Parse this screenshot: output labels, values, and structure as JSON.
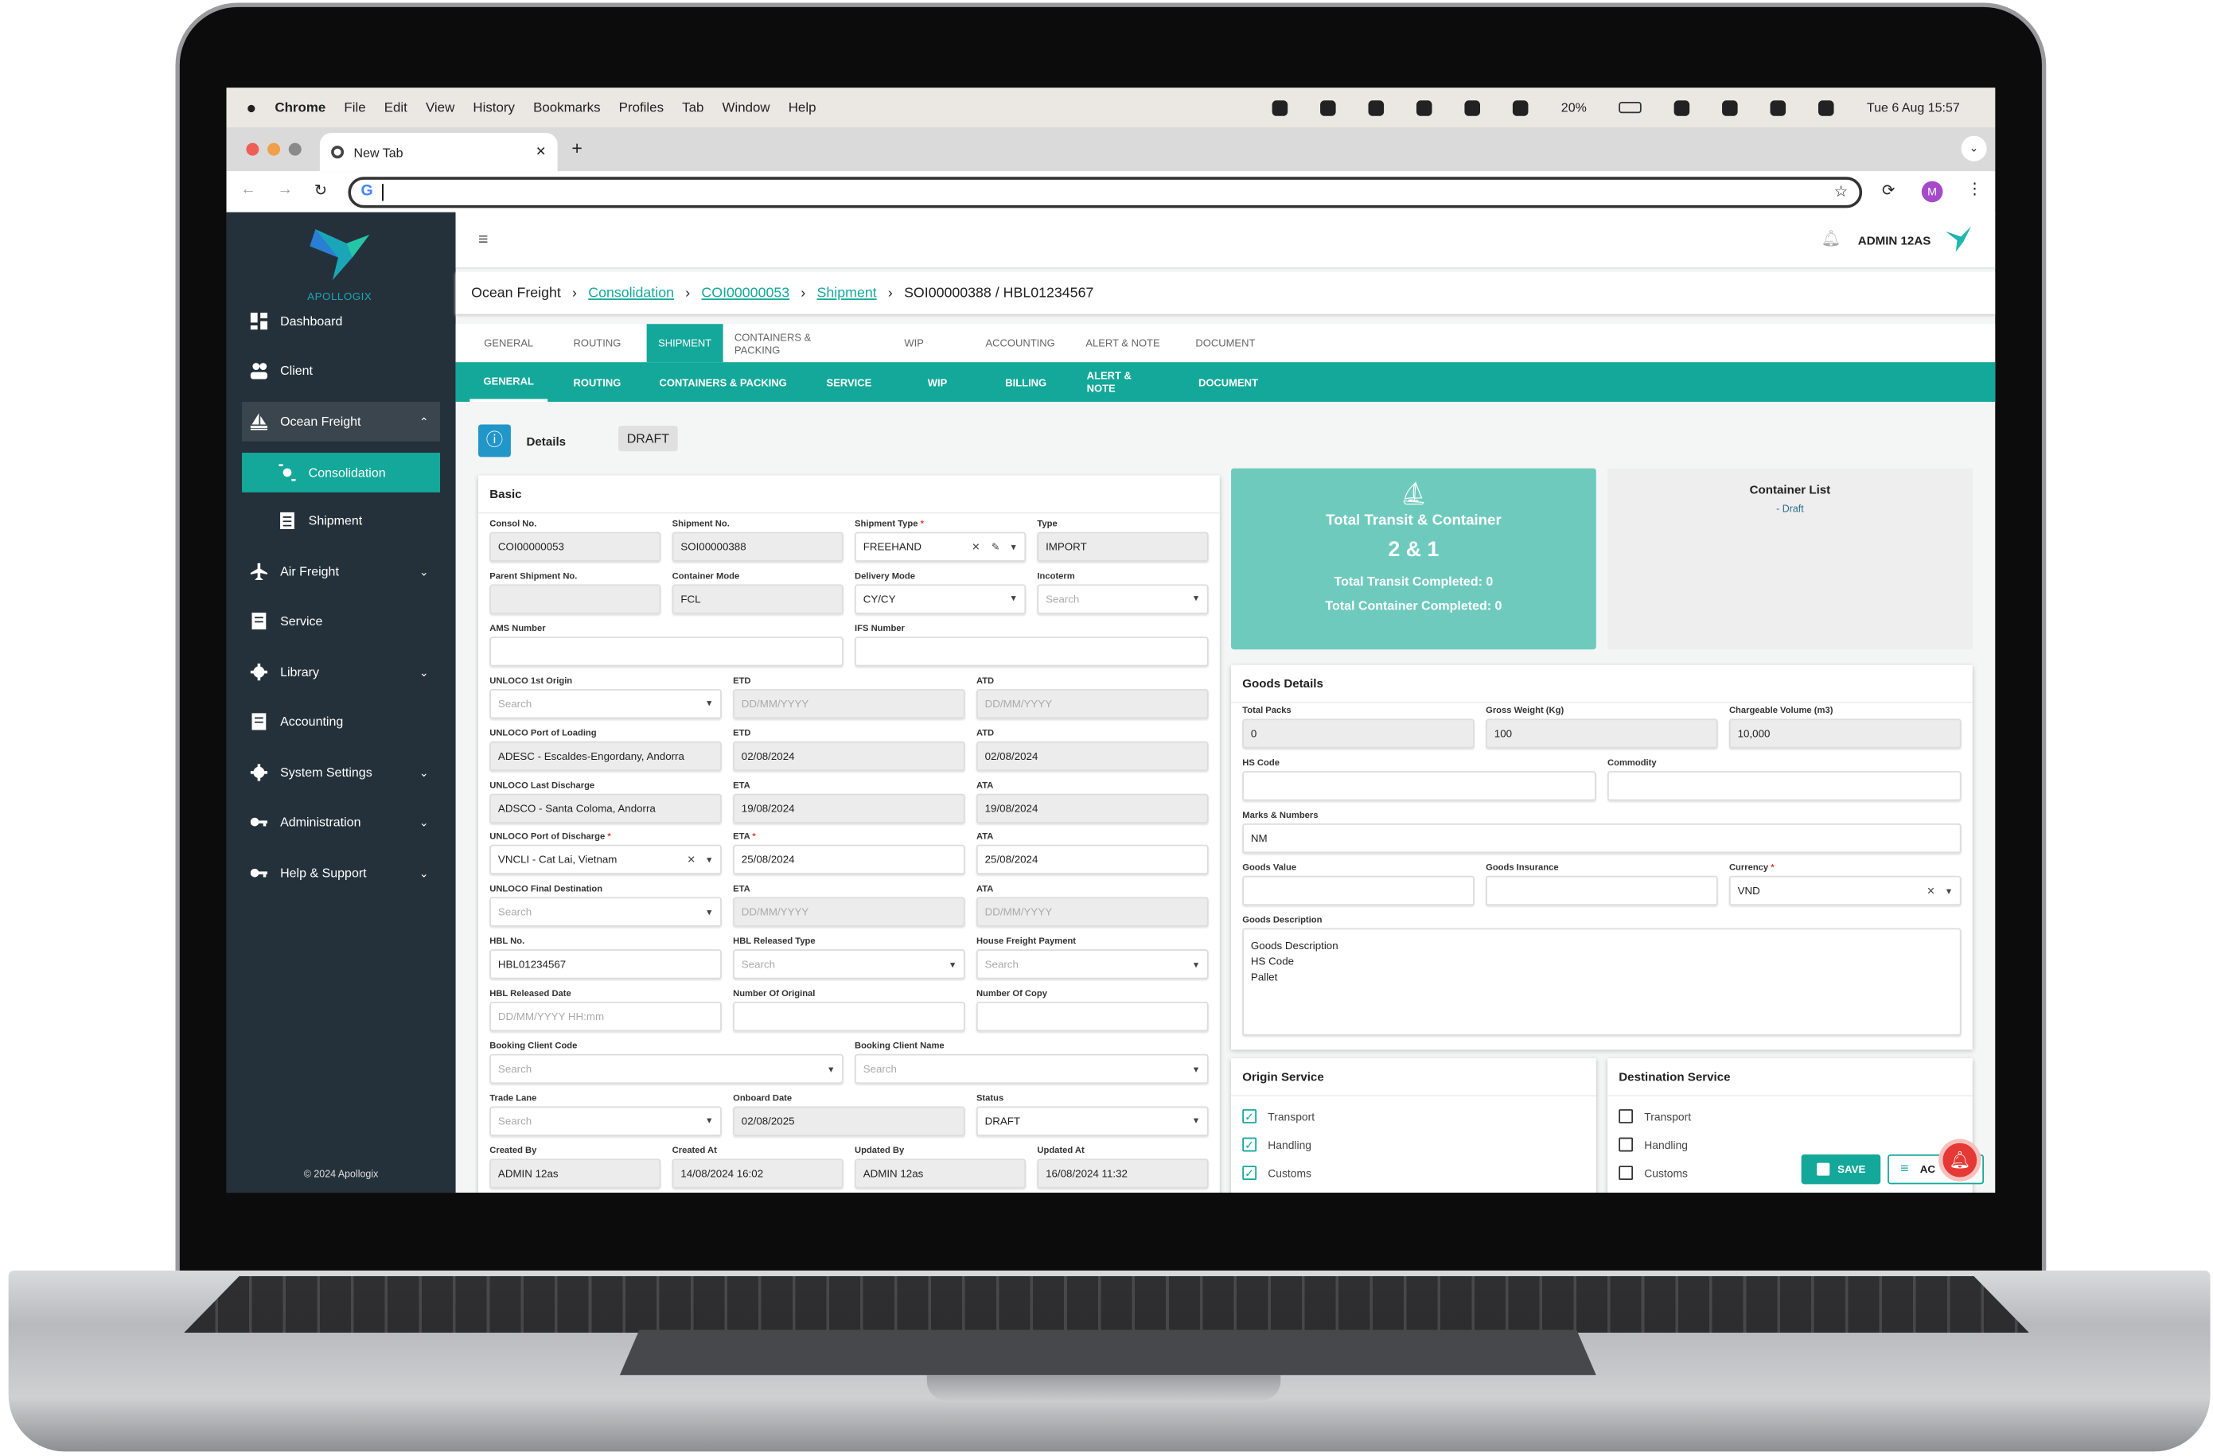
{
  "colors": {
    "accent": "#14a89a",
    "sidebar": "#25313a",
    "summary": "#6fcabe",
    "alert": "#e53935"
  },
  "mac_menu": {
    "items": [
      "Chrome",
      "File",
      "Edit",
      "View",
      "History",
      "Bookmarks",
      "Profiles",
      "Tab",
      "Window",
      "Help"
    ],
    "battery": "20%",
    "datetime": "Tue 6 Aug  15:57",
    "status_icons": [
      "vivaldi-icon",
      "screen-icon",
      "cloud-icon",
      "chat-icon",
      "grammarly-icon",
      "check-icon",
      "wifi-icon",
      "search-icon",
      "control-center-icon",
      "siri-icon"
    ]
  },
  "browser": {
    "tab_title": "New Tab",
    "new_tab": "+",
    "address": "",
    "avatar": "M"
  },
  "sidebar": {
    "logo": "APOLLOGIX",
    "footer": "© 2024 Apollogix",
    "items": [
      {
        "label": "Dashboard",
        "icon": "dashboard-icon"
      },
      {
        "label": "Client",
        "icon": "users-icon"
      },
      {
        "label": "Ocean Freight",
        "icon": "ship-icon",
        "expanded": true
      },
      {
        "label": "Consolidation",
        "icon": "consolidation-icon",
        "sub": true,
        "active": true
      },
      {
        "label": "Shipment",
        "icon": "document-icon",
        "sub": true
      },
      {
        "label": "Air Freight",
        "icon": "plane-icon",
        "chevron": true
      },
      {
        "label": "Service",
        "icon": "list-icon"
      },
      {
        "label": "Library",
        "icon": "gear-icon",
        "chevron": true
      },
      {
        "label": "Accounting",
        "icon": "list-icon"
      },
      {
        "label": "System Settings",
        "icon": "gear-icon",
        "chevron": true
      },
      {
        "label": "Administration",
        "icon": "key-icon",
        "chevron": true
      },
      {
        "label": "Help & Support",
        "icon": "key-icon",
        "chevron": true
      }
    ]
  },
  "header": {
    "user": "ADMIN 12AS"
  },
  "breadcrumb": {
    "root": "Ocean Freight",
    "links": [
      "Consolidation",
      "COI00000053",
      "Shipment"
    ],
    "current": "SOI00000388 / HBL01234567"
  },
  "tabs_primary": [
    {
      "label": "General"
    },
    {
      "label": "Routing"
    },
    {
      "label": "Shipment",
      "active": true
    },
    {
      "label": "Containers & Packing"
    },
    {
      "label": "WIP"
    },
    {
      "label": "Accounting"
    },
    {
      "label": "Alert & Note"
    },
    {
      "label": "Document"
    }
  ],
  "tabs_secondary": [
    {
      "label": "General",
      "active": true
    },
    {
      "label": "Routing"
    },
    {
      "label": "Containers & Packing"
    },
    {
      "label": "Service"
    },
    {
      "label": "WIP"
    },
    {
      "label": "Billing"
    },
    {
      "label": "Alert & Note"
    },
    {
      "label": "Document"
    }
  ],
  "details": {
    "title": "Details",
    "status_badge": "DRAFT",
    "section": "Basic"
  },
  "basic_rows": [
    [
      {
        "label": "Consol No.",
        "value": "COI00000053",
        "disabled": true
      },
      {
        "label": "Shipment No.",
        "value": "SOI00000388",
        "disabled": true
      },
      {
        "label": "Shipment Type",
        "required": true,
        "value": "FREEHAND",
        "select": true,
        "clear": true,
        "edit": true
      },
      {
        "label": "Type",
        "value": "IMPORT",
        "disabled": true
      }
    ],
    [
      {
        "label": "Parent Shipment No.",
        "value": "",
        "disabled": true
      },
      {
        "label": "Container Mode",
        "value": "FCL",
        "disabled": true
      },
      {
        "label": "Delivery Mode",
        "value": "CY/CY",
        "select": true
      },
      {
        "label": "Incoterm",
        "placeholder": "Search",
        "select": true
      }
    ],
    [
      {
        "label": "AMS Number",
        "value": ""
      },
      {
        "label": "IFS Number",
        "value": ""
      }
    ],
    [
      {
        "label": "UNLOCO 1st Origin",
        "placeholder": "Search",
        "select": true
      },
      {
        "label": "ETD",
        "placeholder": "DD/MM/YYYY",
        "disabled": true
      },
      {
        "label": "ATD",
        "placeholder": "DD/MM/YYYY",
        "disabled": true
      }
    ],
    [
      {
        "label": "UNLOCO Port of Loading",
        "value": "ADESC - Escaldes-Engordany, Andorra",
        "disabled": true
      },
      {
        "label": "ETD",
        "value": "02/08/2024",
        "disabled": true
      },
      {
        "label": "ATD",
        "value": "02/08/2024",
        "disabled": true
      }
    ],
    [
      {
        "label": "UNLOCO Last Discharge",
        "value": "ADSCO - Santa Coloma, Andorra",
        "disabled": true
      },
      {
        "label": "ETA",
        "value": "19/08/2024",
        "disabled": true
      },
      {
        "label": "ATA",
        "value": "19/08/2024",
        "disabled": true
      }
    ],
    [
      {
        "label": "UNLOCO Port of Discharge",
        "required": true,
        "value": "VNCLI - Cat Lai, Vietnam",
        "select": true,
        "clear": true
      },
      {
        "label": "ETA",
        "required": true,
        "value": "25/08/2024"
      },
      {
        "label": "ATA",
        "value": "25/08/2024"
      }
    ],
    [
      {
        "label": "UNLOCO Final Destination",
        "placeholder": "Search",
        "select": true
      },
      {
        "label": "ETA",
        "placeholder": "DD/MM/YYYY",
        "disabled": true
      },
      {
        "label": "ATA",
        "placeholder": "DD/MM/YYYY",
        "disabled": true
      }
    ],
    [
      {
        "label": "HBL No.",
        "value": "HBL01234567"
      },
      {
        "label": "HBL Released Type",
        "placeholder": "Search",
        "select": true
      },
      {
        "label": "House Freight Payment",
        "placeholder": "Search",
        "select": true
      }
    ],
    [
      {
        "label": "HBL Released Date",
        "placeholder": "DD/MM/YYYY HH:mm"
      },
      {
        "label": "Number Of Original",
        "value": ""
      },
      {
        "label": "Number Of Copy",
        "value": ""
      }
    ],
    [
      {
        "label": "Booking Client Code",
        "placeholder": "Search",
        "select": true
      },
      {
        "label": "Booking Client Name",
        "placeholder": "Search",
        "select": true
      }
    ],
    [
      {
        "label": "Trade Lane",
        "placeholder": "Search",
        "select": true
      },
      {
        "label": "Onboard Date",
        "value": "02/08/2025",
        "disabled": true
      },
      {
        "label": "Status",
        "value": "DRAFT",
        "select": true
      }
    ],
    [
      {
        "label": "Created By",
        "value": "ADMIN 12as",
        "disabled": true
      },
      {
        "label": "Created At",
        "value": "14/08/2024 16:02",
        "disabled": true
      },
      {
        "label": "Updated By",
        "value": "ADMIN 12as",
        "disabled": true
      },
      {
        "label": "Updated At",
        "value": "16/08/2024 11:32",
        "disabled": true
      }
    ]
  ],
  "summary": {
    "title": "Total Transit & Container",
    "value": "2 & 1",
    "transit_completed": "Total Transit Completed: 0",
    "container_completed": "Total Container Completed: 0"
  },
  "container_list": {
    "title": "Container List",
    "items": [
      "- Draft"
    ]
  },
  "goods": {
    "title": "Goods Details",
    "rows": [
      [
        {
          "label": "Total Packs",
          "value": "0",
          "disabled": true
        },
        {
          "label": "Gross Weight (Kg)",
          "value": "100",
          "disabled": true
        },
        {
          "label": "Chargeable Volume (m3)",
          "value": "10,000",
          "disabled": true
        }
      ],
      [
        {
          "label": "HS Code",
          "value": ""
        },
        {
          "label": "Commodity",
          "value": ""
        }
      ],
      [
        {
          "label": "Marks & Numbers",
          "value": "NM"
        }
      ],
      [
        {
          "label": "Goods Value",
          "value": ""
        },
        {
          "label": "Goods Insurance",
          "value": ""
        },
        {
          "label": "Currency",
          "required": true,
          "value": "VND",
          "select": true,
          "clear": true
        }
      ],
      [
        {
          "label": "Goods Description",
          "value": "Goods Description\nHS Code\nPallet",
          "textarea": true
        }
      ]
    ]
  },
  "origin_service": {
    "title": "Origin Service",
    "items": [
      {
        "label": "Transport",
        "checked": true
      },
      {
        "label": "Handling",
        "checked": true
      },
      {
        "label": "Customs",
        "checked": true
      }
    ]
  },
  "destination_service": {
    "title": "Destination Service",
    "items": [
      {
        "label": "Transport",
        "checked": false
      },
      {
        "label": "Handling",
        "checked": false
      },
      {
        "label": "Customs",
        "checked": false
      }
    ]
  },
  "actions": {
    "save": "SAVE",
    "more": "AC"
  }
}
